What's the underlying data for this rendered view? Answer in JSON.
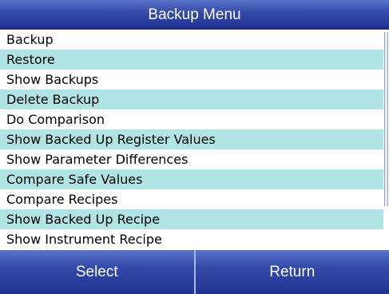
{
  "header": {
    "title": "Backup Menu"
  },
  "menu": {
    "items": [
      {
        "label": "Backup"
      },
      {
        "label": "Restore"
      },
      {
        "label": "Show Backups"
      },
      {
        "label": "Delete Backup"
      },
      {
        "label": "Do Comparison"
      },
      {
        "label": "Show Backed Up Register Values"
      },
      {
        "label": "Show Parameter Differences"
      },
      {
        "label": "Compare Safe Values"
      },
      {
        "label": "Compare Recipes"
      },
      {
        "label": "Show Backed Up Recipe"
      },
      {
        "label": "Show Instrument Recipe"
      }
    ]
  },
  "footer": {
    "select_label": "Select",
    "return_label": "Return"
  },
  "colors": {
    "header_bar": "#3349a8",
    "alt_row": "#b1e4e4",
    "row": "#ffffff",
    "button": "#2a3fa0"
  }
}
